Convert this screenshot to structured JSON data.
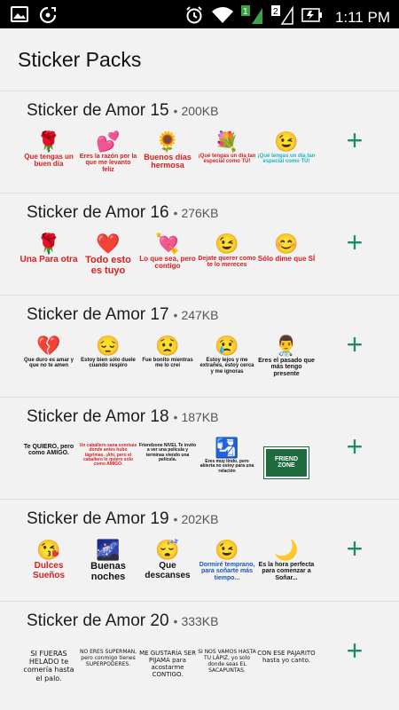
{
  "status_bar": {
    "time": "1:11 PM",
    "sim1_label": "1",
    "sim2_label": "2",
    "icons": [
      "image-icon",
      "sync-icon",
      "alarm-icon",
      "wifi-icon",
      "signal-icon",
      "signal-icon",
      "battery-icon"
    ]
  },
  "header": {
    "title": "Sticker Packs"
  },
  "colors": {
    "accent": "#1f8a6f",
    "background": "#f2f2f2",
    "divider": "#dcdcdc"
  },
  "packs": [
    {
      "name": "Sticker de Amor 15",
      "size": "200KB",
      "add_icon": "+",
      "stickers": [
        {
          "emoji": "🌹",
          "text": "Que tengas un buen día",
          "color": "#d61f1f",
          "style": "bold",
          "fs": 8
        },
        {
          "emoji": "💕",
          "text": "Eres la razón por la que me levanto feliz",
          "color": "#d61f1f",
          "style": "bold",
          "fs": 7
        },
        {
          "emoji": "🌻",
          "text": "Buenos días hermosa",
          "color": "#d61f1f",
          "style": "bold",
          "fs": 9
        },
        {
          "emoji": "💐",
          "text": "¡Qué tengas un día tan especial como TÚ!",
          "color": "#d61f1f",
          "style": "bold",
          "fs": 6
        },
        {
          "emoji": "😉",
          "text": "¡Qué tengas un día tan especial como TÚ!",
          "color": "#18b7c0",
          "style": "bold",
          "fs": 6
        }
      ]
    },
    {
      "name": "Sticker de Amor 16",
      "size": "276KB",
      "add_icon": "+",
      "stickers": [
        {
          "emoji": "🌹",
          "text": "Una Para otra",
          "color": "#d61f1f",
          "style": "bold",
          "fs": 10
        },
        {
          "emoji": "❤️",
          "text": "Todo esto es tuyo",
          "color": "#d61f1f",
          "style": "bold",
          "fs": 11
        },
        {
          "emoji": "💘",
          "text": "Lo que sea, pero contigo",
          "color": "#d61f1f",
          "style": "bold",
          "fs": 8
        },
        {
          "emoji": "😉",
          "text": "Dejate querer como te lo mereces",
          "color": "#d61f1f",
          "style": "bold",
          "fs": 7
        },
        {
          "emoji": "😊",
          "text": "Sólo dime que SÍ",
          "color": "#d61f1f",
          "style": "bold",
          "fs": 8
        }
      ]
    },
    {
      "name": "Sticker de Amor 17",
      "size": "247KB",
      "add_icon": "+",
      "stickers": [
        {
          "emoji": "💔",
          "text": "Que duro es amar y que no te amen",
          "color": "#111111",
          "style": "bold",
          "fs": 6
        },
        {
          "emoji": "😔",
          "text": "Estoy bien sólo duele cuando respiro",
          "color": "#111111",
          "style": "bold",
          "fs": 6
        },
        {
          "emoji": "😟",
          "text": "Fue bonito mientras me lo creí",
          "color": "#111111",
          "style": "bold",
          "fs": 6
        },
        {
          "emoji": "😢",
          "text": "Estoy lejos y me extrañes, estoy cerca y me ignoras",
          "color": "#111111",
          "style": "bold",
          "fs": 6
        },
        {
          "emoji": "👨‍⚕️",
          "text": "Eres el pasado que más tengo presente",
          "color": "#111111",
          "style": "bold",
          "fs": 7
        }
      ]
    },
    {
      "name": "Sticker de Amor 18",
      "size": "187KB",
      "add_icon": "+",
      "stickers": [
        {
          "emoji": "",
          "text": "Te QUIERO, pero como AMIGO.",
          "color": "#111111",
          "style": "bold",
          "fs": 7
        },
        {
          "emoji": "",
          "text": "Un caballero sana sonrisas donde antes hubo lágrimas. ¡Ahí, pero el caballero lo quiero solo como AMIGO.",
          "color": "#d61f1f",
          "style": "bold",
          "fs": 5
        },
        {
          "emoji": "",
          "text": "Friendzone NIVEL Te invito a ver una película y terminas viendo una película.",
          "color": "#111111",
          "style": "bold",
          "fs": 5
        },
        {
          "emoji": "🛂",
          "text": "Eres muy lindo, pero abierta no estoy para una relación",
          "color": "#111111",
          "style": "bold",
          "fs": 5
        },
        {
          "emoji": "",
          "text": "FRIEND ZONE",
          "color": "#ffffff",
          "style": "sign",
          "fs": 7
        }
      ]
    },
    {
      "name": "Sticker de Amor 19",
      "size": "202KB",
      "add_icon": "+",
      "stickers": [
        {
          "emoji": "😘",
          "text": "Dulces Sueños",
          "color": "#d61f1f",
          "style": "bold",
          "fs": 10
        },
        {
          "emoji": "🌌",
          "text": "Buenas noches",
          "color": "#111111",
          "style": "bold",
          "fs": 11
        },
        {
          "emoji": "😴",
          "text": "Que descanses",
          "color": "#111111",
          "style": "bold",
          "fs": 10
        },
        {
          "emoji": "😉",
          "text": "Dormiré temprano, para soñarte más tiempo...",
          "color": "#1a56b8",
          "style": "bold",
          "fs": 7
        },
        {
          "emoji": "🌙",
          "text": "Es la hora perfecta para comenzar a Soñar...",
          "color": "#111111",
          "style": "bold",
          "fs": 7
        }
      ]
    },
    {
      "name": "Sticker de Amor 20",
      "size": "333KB",
      "add_icon": "+",
      "stickers": [
        {
          "emoji": "",
          "text": "SI FUERAS HELADO te comería hasta el palo.",
          "color": "#111111",
          "style": "plain",
          "fs": 8
        },
        {
          "emoji": "",
          "text": "NO ERES SUPERMAN, pero conmigo tienes SUPERPODERES.",
          "color": "#111111",
          "style": "plain",
          "fs": 6
        },
        {
          "emoji": "",
          "text": "ME GUSTARÍA SER PIJAMA para acostarme CONTIGO.",
          "color": "#111111",
          "style": "plain",
          "fs": 7
        },
        {
          "emoji": "",
          "text": "SI NOS VAMOS HASTA TU LÁPIZ, yo solo donde seas EL SACAPUNTAS.",
          "color": "#111111",
          "style": "plain",
          "fs": 6
        },
        {
          "emoji": "",
          "text": "CON ESE PAJARITO hasta yo canto.",
          "color": "#111111",
          "style": "plain",
          "fs": 7
        }
      ]
    }
  ]
}
